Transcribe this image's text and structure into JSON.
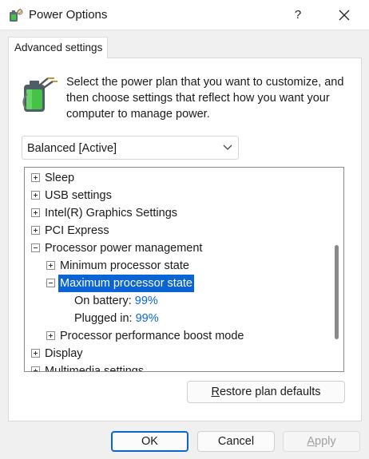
{
  "window": {
    "title": "Power Options",
    "help_glyph": "?"
  },
  "tab": {
    "label": "Advanced settings"
  },
  "description": "Select the power plan that you want to customize, and then choose settings that reflect how you want your computer to manage power.",
  "plan_select": {
    "value": "Balanced [Active]"
  },
  "tree": {
    "sleep": "Sleep",
    "usb": "USB settings",
    "intel": "Intel(R) Graphics Settings",
    "pci": "PCI Express",
    "processor": "Processor power management",
    "min_state": "Minimum processor state",
    "max_state": "Maximum processor state",
    "on_battery_label": "On battery:",
    "on_battery_value": "99%",
    "plugged_label": "Plugged in:",
    "plugged_value": "99%",
    "boost": "Processor performance boost mode",
    "display": "Display",
    "multimedia": "Multimedia settings"
  },
  "buttons": {
    "restore_first": "R",
    "restore_rest": "estore plan defaults",
    "ok": "OK",
    "cancel": "Cancel",
    "apply_first": "A",
    "apply_rest": "pply"
  },
  "colors": {
    "accent": "#0a64d6",
    "battery_green": "#3fb43f"
  },
  "icons": {
    "app": "power-options-icon",
    "battery": "battery-plug-icon",
    "close": "close-icon",
    "chevron": "chevron-down-icon"
  }
}
